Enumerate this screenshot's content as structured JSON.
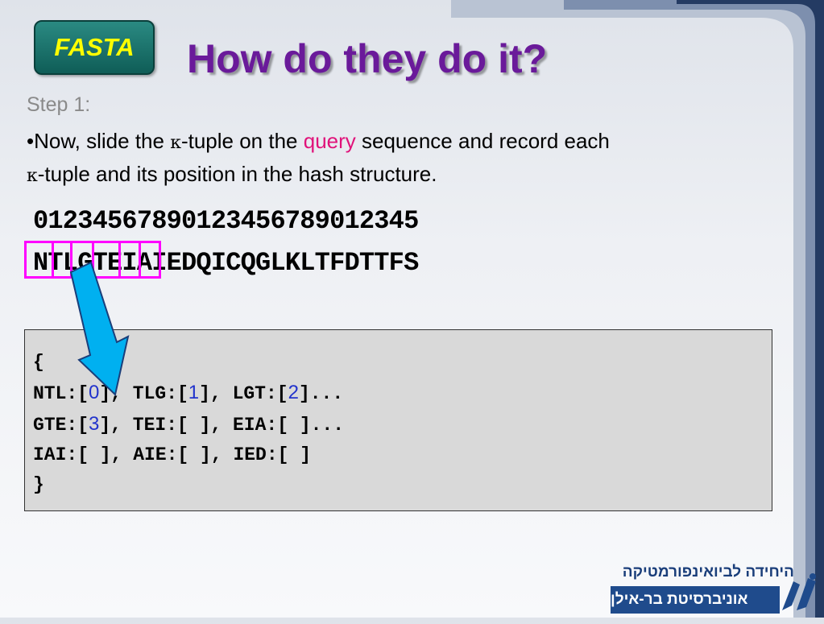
{
  "badge": {
    "label": "FASTA"
  },
  "slide": {
    "title": "How do they do it?",
    "step": "Step 1:",
    "para_prefix": "•Now, slide the ",
    "kappa": "κ",
    "para_mid1": "-tuple on the ",
    "query_word": "query",
    "para_mid2": " sequence and record each ",
    "para_mid3": "-tuple and its position in the hash structure."
  },
  "sequence": {
    "digits": "0123456789012345678901234 5",
    "residues": "NTLGTEIAIEDQICQGLKLTFDTTFS"
  },
  "hash": {
    "open": "{",
    "line1": {
      "a": "NTL:[",
      "n1": "0",
      "b": "], TLG:[",
      "n2": "1",
      "c": "], LGT:[",
      "n3": "2",
      "d": "]..."
    },
    "line2": {
      "a": "GTE:[",
      "n1": "3",
      "b": "], TEI:[ ], EIA:[ ]..."
    },
    "line3": "IAI:[ ], AIE:[ ], IED:[ ]",
    "close": "}"
  },
  "footer": {
    "unit_name": "היחידה לביואינפורמטיקה",
    "university": "אוניברסיטת בר-אילן",
    "logo_glyph": "בא"
  },
  "colors": {
    "title": "#6a1a9a",
    "badge_text": "#ffff00",
    "query": "#e0127a",
    "highlight_box": "#ff00ff",
    "hash_numbers": "#2233cc",
    "arrow": "#00b0f0"
  }
}
